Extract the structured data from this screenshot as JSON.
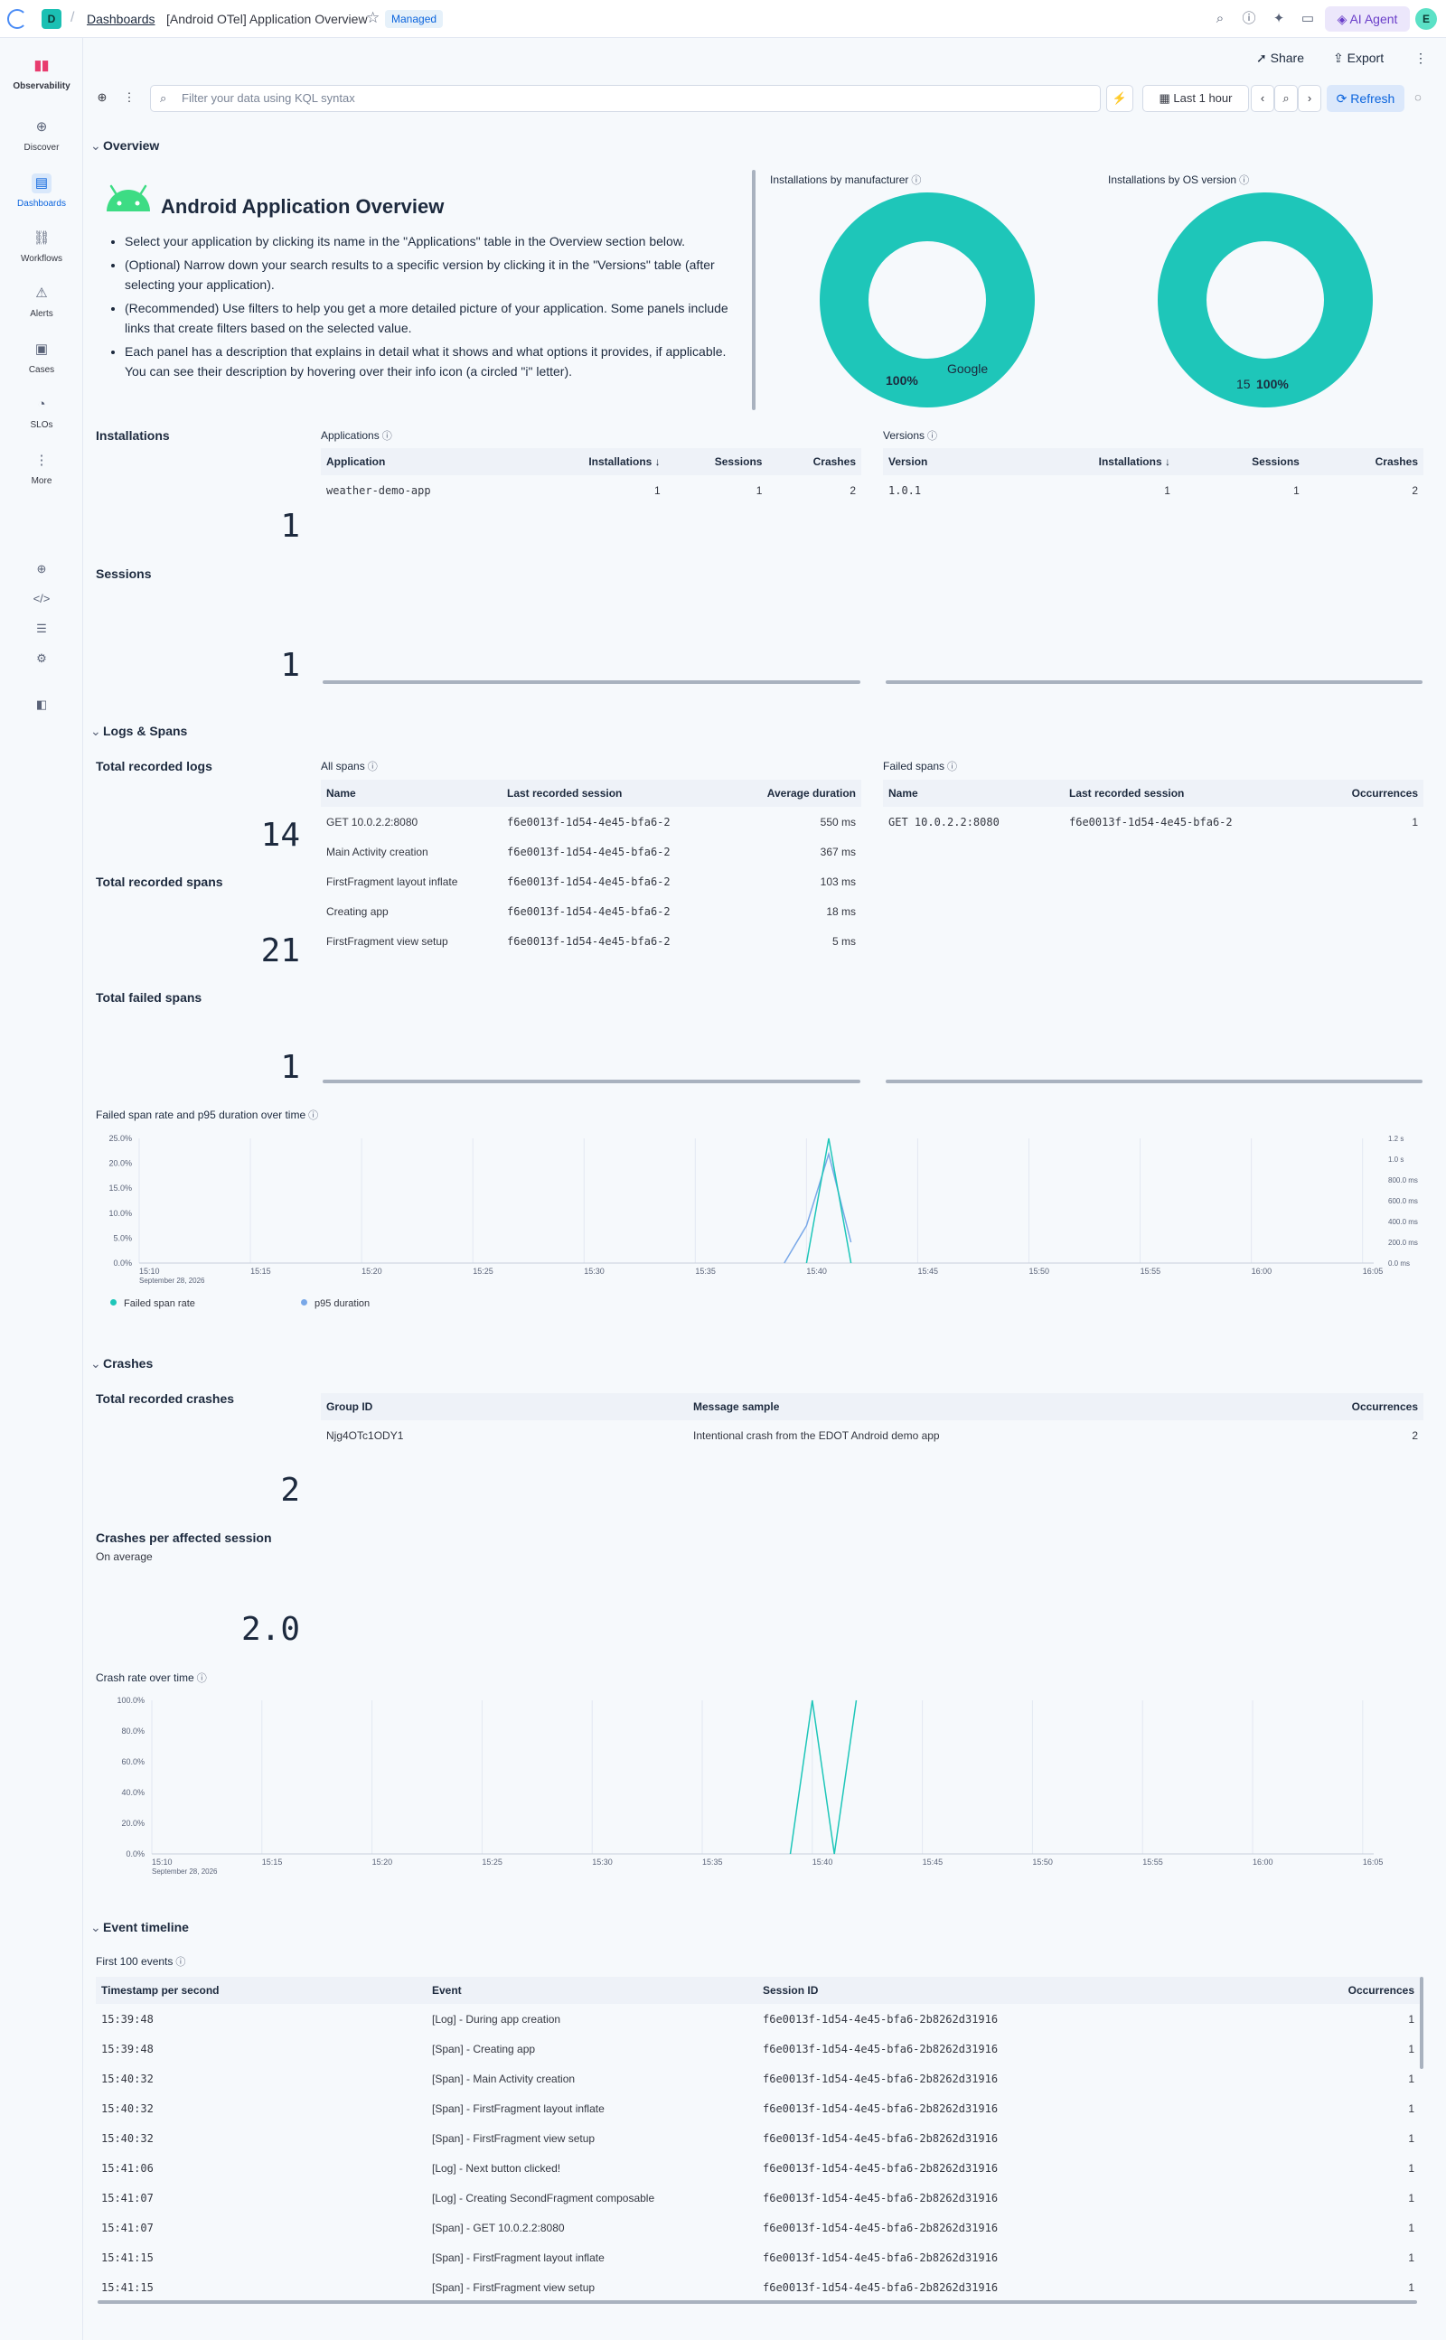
{
  "header": {
    "space_initial": "D",
    "breadcrumb_dashboards": "Dashboards",
    "breadcrumb_title": "[Android OTel] Application Overview",
    "managed_badge": "Managed",
    "ai_agent": "AI Agent",
    "avatar_initial": "E"
  },
  "sidebar": {
    "brand": "Observability",
    "items": [
      {
        "label": "Discover",
        "icon": "discover-icon"
      },
      {
        "label": "Dashboards",
        "icon": "dashboards-icon"
      },
      {
        "label": "Workflows",
        "icon": "workflows-icon"
      },
      {
        "label": "Alerts",
        "icon": "alerts-icon"
      },
      {
        "label": "Cases",
        "icon": "cases-icon"
      },
      {
        "label": "SLOs",
        "icon": "slos-icon"
      },
      {
        "label": "More",
        "icon": "more-icon"
      }
    ]
  },
  "toolbar": {
    "share": "Share",
    "export": "Export",
    "kql_placeholder": "Filter your data using KQL syntax",
    "time_range": "Last 1 hour",
    "refresh": "Refresh"
  },
  "overview": {
    "section_title": "Overview",
    "md_title": "Android Application Overview",
    "md_bullets": [
      "Select your application by clicking its name in the \"Applications\" table in the Overview section below.",
      "(Optional) Narrow down your search results to a specific version by clicking it in the \"Versions\" table (after selecting your application).",
      "(Recommended) Use filters to help you get a more detailed picture of your application. Some panels include links that create filters based on the selected value.",
      "Each panel has a description that explains in detail what it shows and what options it provides, if applicable. You can see their description by hovering over their info icon (a circled \"i\" letter)."
    ],
    "installations_title": "Installations",
    "installations_value": "1",
    "sessions_title": "Sessions",
    "sessions_value": "1",
    "donut_manufacturer": {
      "title": "Installations by manufacturer",
      "slice_label": "Google",
      "pct": "100%"
    },
    "donut_os": {
      "title": "Installations by OS version",
      "slice_label": "15",
      "pct": "100%"
    },
    "applications": {
      "title": "Applications",
      "headers": [
        "Application",
        "Installations ↓",
        "Sessions",
        "Crashes"
      ],
      "rows": [
        [
          "weather-demo-app",
          "1",
          "1",
          "2"
        ]
      ]
    },
    "versions": {
      "title": "Versions",
      "headers": [
        "Version",
        "Installations ↓",
        "Sessions",
        "Crashes"
      ],
      "rows": [
        [
          "1.0.1",
          "1",
          "1",
          "2"
        ]
      ]
    }
  },
  "logs_spans": {
    "section_title": "Logs & Spans",
    "total_logs_title": "Total recorded logs",
    "total_logs_value": "14",
    "total_spans_title": "Total recorded spans",
    "total_spans_value": "21",
    "total_failed_title": "Total failed spans",
    "total_failed_value": "1",
    "all_spans": {
      "title": "All spans",
      "headers": [
        "Name",
        "Last recorded session",
        "Average duration"
      ],
      "rows": [
        [
          "GET 10.0.2.2:8080",
          "f6e0013f-1d54-4e45-bfa6-2",
          "550 ms"
        ],
        [
          "Main Activity creation",
          "f6e0013f-1d54-4e45-bfa6-2",
          "367 ms"
        ],
        [
          "FirstFragment layout inflate",
          "f6e0013f-1d54-4e45-bfa6-2",
          "103 ms"
        ],
        [
          "Creating app",
          "f6e0013f-1d54-4e45-bfa6-2",
          "18 ms"
        ],
        [
          "FirstFragment view setup",
          "f6e0013f-1d54-4e45-bfa6-2",
          "5 ms"
        ]
      ]
    },
    "failed_spans": {
      "title": "Failed spans",
      "headers": [
        "Name",
        "Last recorded session",
        "Occurrences"
      ],
      "rows": [
        [
          "GET 10.0.2.2:8080",
          "f6e0013f-1d54-4e45-bfa6-2",
          "1"
        ]
      ]
    },
    "chart_title": "Failed span rate and p95 duration over time"
  },
  "crashes": {
    "section_title": "Crashes",
    "total_title": "Total recorded crashes",
    "total_value": "2",
    "per_session_title": "Crashes per affected session",
    "per_session_sub": "On average",
    "per_session_value": "2.0",
    "table": {
      "headers": [
        "Group ID",
        "Message sample",
        "Occurrences"
      ],
      "rows": [
        [
          "Njg4OTc1ODY1",
          "Intentional crash from the EDOT Android demo app",
          "2"
        ]
      ]
    },
    "chart_title": "Crash rate over time"
  },
  "timeline": {
    "section_title": "Event timeline",
    "panel_title": "First 100 events",
    "headers": [
      "Timestamp per second",
      "Event",
      "Session ID",
      "Occurrences"
    ],
    "rows": [
      [
        "15:39:48",
        "[Log] - During app creation",
        "f6e0013f-1d54-4e45-bfa6-2b8262d31916",
        "1"
      ],
      [
        "15:39:48",
        "[Span] - Creating app",
        "f6e0013f-1d54-4e45-bfa6-2b8262d31916",
        "1"
      ],
      [
        "15:40:32",
        "[Span] - Main Activity creation",
        "f6e0013f-1d54-4e45-bfa6-2b8262d31916",
        "1"
      ],
      [
        "15:40:32",
        "[Span] - FirstFragment layout inflate",
        "f6e0013f-1d54-4e45-bfa6-2b8262d31916",
        "1"
      ],
      [
        "15:40:32",
        "[Span] - FirstFragment view setup",
        "f6e0013f-1d54-4e45-bfa6-2b8262d31916",
        "1"
      ],
      [
        "15:41:06",
        "[Log] - Next button clicked!",
        "f6e0013f-1d54-4e45-bfa6-2b8262d31916",
        "1"
      ],
      [
        "15:41:07",
        "[Log] - Creating SecondFragment composable",
        "f6e0013f-1d54-4e45-bfa6-2b8262d31916",
        "1"
      ],
      [
        "15:41:07",
        "[Span] - GET 10.0.2.2:8080",
        "f6e0013f-1d54-4e45-bfa6-2b8262d31916",
        "1"
      ],
      [
        "15:41:15",
        "[Span] - FirstFragment layout inflate",
        "f6e0013f-1d54-4e45-bfa6-2b8262d31916",
        "1"
      ],
      [
        "15:41:15",
        "[Span] - FirstFragment view setup",
        "f6e0013f-1d54-4e45-bfa6-2b8262d31916",
        "1"
      ]
    ]
  },
  "colors": {
    "teal": "#1ec6b9",
    "blue": "#79a8e8",
    "link": "#0b64dd"
  },
  "chart_data": [
    {
      "type": "line",
      "title": "Failed span rate and p95 duration over time",
      "x_ticks": [
        "15:10",
        "15:15",
        "15:20",
        "15:25",
        "15:30",
        "15:35",
        "15:40",
        "15:45",
        "15:50",
        "15:55",
        "16:00",
        "16:05"
      ],
      "x_date": "September 28, 2026",
      "y_left_ticks": [
        "25.0%",
        "20.0%",
        "15.0%",
        "10.0%",
        "5.0%",
        "0.0%"
      ],
      "y_right_ticks": [
        "1.2 s",
        "1.0 s",
        "800.0 ms",
        "600.0 ms",
        "400.0 ms",
        "200.0 ms",
        "0.0 ms"
      ],
      "ylim_left": [
        0,
        25
      ],
      "ylim_right_ms": [
        0,
        1200
      ],
      "series": [
        {
          "name": "Failed span rate",
          "axis": "left",
          "x": [
            "15:40",
            "15:41",
            "15:42"
          ],
          "values": [
            0,
            25,
            0
          ]
        },
        {
          "name": "p95 duration",
          "axis": "right",
          "x": [
            "15:39",
            "15:40",
            "15:41",
            "15:42"
          ],
          "values": [
            0,
            360,
            1050,
            200
          ]
        }
      ],
      "legend": "bottom-left"
    },
    {
      "type": "line",
      "title": "Crash rate over time",
      "x_ticks": [
        "15:10",
        "15:15",
        "15:20",
        "15:25",
        "15:30",
        "15:35",
        "15:40",
        "15:45",
        "15:50",
        "15:55",
        "16:00",
        "16:05"
      ],
      "x_date": "September 28, 2026",
      "y_ticks": [
        "100.0%",
        "80.0%",
        "60.0%",
        "40.0%",
        "20.0%",
        "0.0%"
      ],
      "ylim": [
        0,
        100
      ],
      "series": [
        {
          "x": [
            "15:39",
            "15:40",
            "15:41",
            "15:42"
          ],
          "values": [
            0,
            100,
            0,
            100
          ]
        }
      ]
    }
  ]
}
